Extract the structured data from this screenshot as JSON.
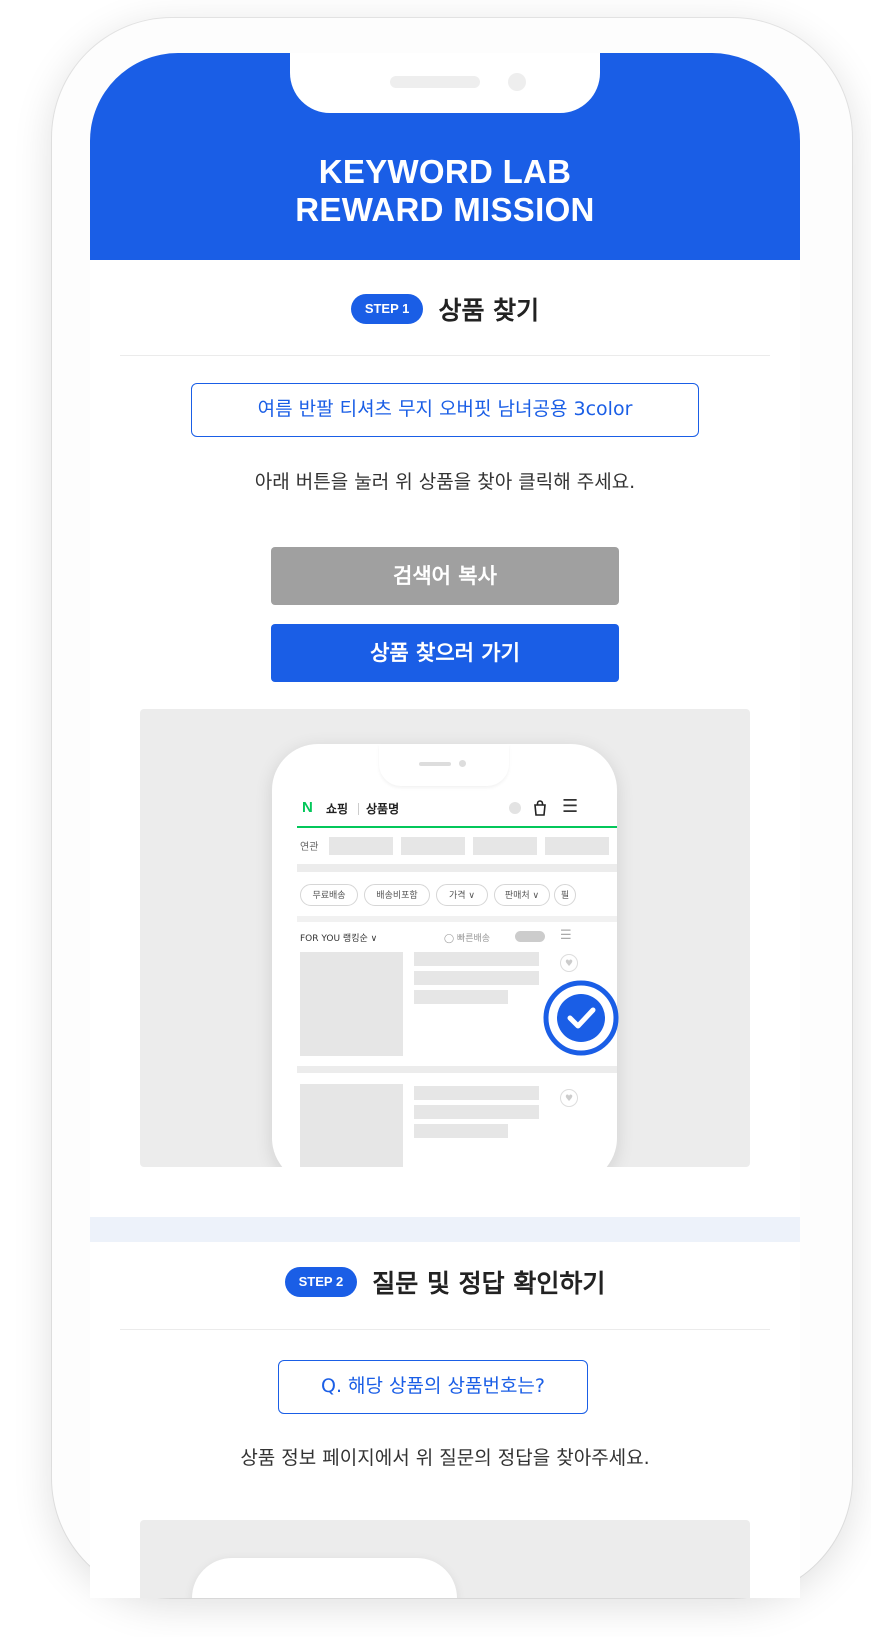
{
  "header": {
    "title_line1": "KEYWORD LAB",
    "title_line2": "REWARD MISSION"
  },
  "step1": {
    "badge": "STEP 1",
    "title": "상품 찾기",
    "keyword": "여름 반팔 티셔츠 무지 오버핏 남녀공용 3color",
    "instruction": "아래 버튼을 눌러 위 상품을 찾아 클릭해 주세요.",
    "copy_button": "검색어 복사",
    "find_button": "상품 찾으러 가기",
    "illustration": {
      "logo": "N",
      "shop_label": "쇼핑",
      "query_label": "상품명",
      "related_label": "연관",
      "filters": [
        "무료배송",
        "배송비포함",
        "가격 ∨",
        "판매처 ∨",
        "필"
      ],
      "sort_label": "FOR YOU 랭킹순 ∨",
      "fast_label": "◯ 빠른배송",
      "bag_icon": "shopping-bag-icon",
      "menu_icon": "hamburger-menu-icon",
      "check_icon": "check-circle-icon",
      "heart_icon": "heart-icon"
    }
  },
  "step2": {
    "badge": "STEP 2",
    "title": "질문 및 정답 확인하기",
    "question": "Q. 해당 상품의 상품번호는?",
    "instruction": "상품 정보 페이지에서 위 질문의 정답을 찾아주세요."
  },
  "colors": {
    "primary": "#1a5ee6",
    "copy_button": "#a0a0a0",
    "naver_green": "#03c75a",
    "section_band": "#edf2fa"
  }
}
